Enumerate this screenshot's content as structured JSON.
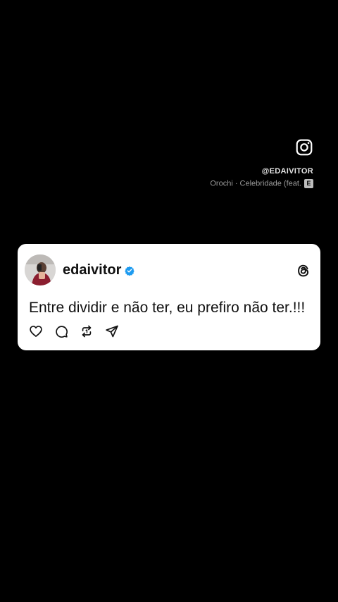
{
  "instagram": {
    "icon": "instagram-icon",
    "handle": "@EDAIVITOR",
    "music": "Orochi · Celebridade (feat.",
    "explicit_badge": "E"
  },
  "post": {
    "username": "edaivitor",
    "verified_icon": "verified-badge-icon",
    "verified_color": "#1d9bf0",
    "platform_icon": "threads-icon",
    "text": "Entre dividir e não ter, eu prefiro não ter.!!!",
    "actions": [
      "heart-icon",
      "comment-icon",
      "repost-icon",
      "share-icon"
    ]
  }
}
